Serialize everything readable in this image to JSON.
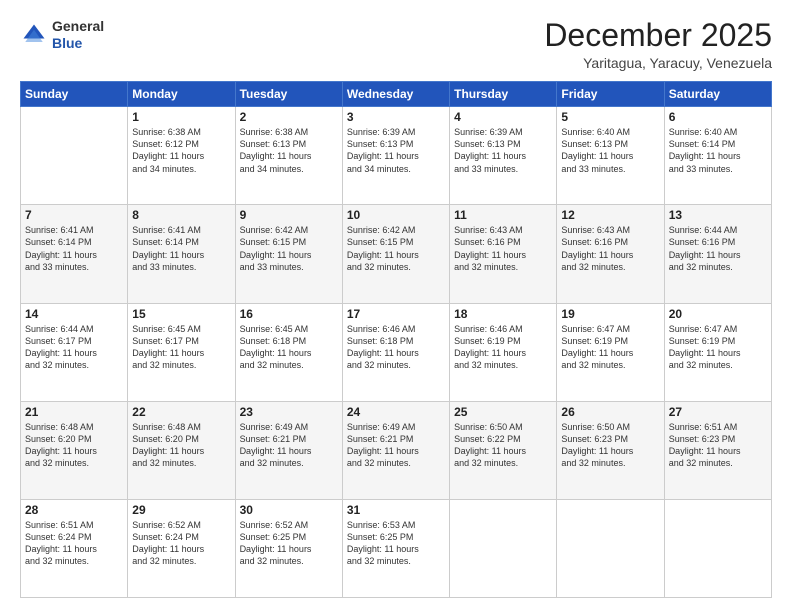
{
  "header": {
    "logo_line1": "General",
    "logo_line2": "Blue",
    "month": "December 2025",
    "location": "Yaritagua, Yaracuy, Venezuela"
  },
  "weekdays": [
    "Sunday",
    "Monday",
    "Tuesday",
    "Wednesday",
    "Thursday",
    "Friday",
    "Saturday"
  ],
  "weeks": [
    [
      {
        "day": "",
        "info": ""
      },
      {
        "day": "1",
        "info": "Sunrise: 6:38 AM\nSunset: 6:12 PM\nDaylight: 11 hours\nand 34 minutes."
      },
      {
        "day": "2",
        "info": "Sunrise: 6:38 AM\nSunset: 6:13 PM\nDaylight: 11 hours\nand 34 minutes."
      },
      {
        "day": "3",
        "info": "Sunrise: 6:39 AM\nSunset: 6:13 PM\nDaylight: 11 hours\nand 34 minutes."
      },
      {
        "day": "4",
        "info": "Sunrise: 6:39 AM\nSunset: 6:13 PM\nDaylight: 11 hours\nand 33 minutes."
      },
      {
        "day": "5",
        "info": "Sunrise: 6:40 AM\nSunset: 6:13 PM\nDaylight: 11 hours\nand 33 minutes."
      },
      {
        "day": "6",
        "info": "Sunrise: 6:40 AM\nSunset: 6:14 PM\nDaylight: 11 hours\nand 33 minutes."
      }
    ],
    [
      {
        "day": "7",
        "info": "Sunrise: 6:41 AM\nSunset: 6:14 PM\nDaylight: 11 hours\nand 33 minutes."
      },
      {
        "day": "8",
        "info": "Sunrise: 6:41 AM\nSunset: 6:14 PM\nDaylight: 11 hours\nand 33 minutes."
      },
      {
        "day": "9",
        "info": "Sunrise: 6:42 AM\nSunset: 6:15 PM\nDaylight: 11 hours\nand 33 minutes."
      },
      {
        "day": "10",
        "info": "Sunrise: 6:42 AM\nSunset: 6:15 PM\nDaylight: 11 hours\nand 32 minutes."
      },
      {
        "day": "11",
        "info": "Sunrise: 6:43 AM\nSunset: 6:16 PM\nDaylight: 11 hours\nand 32 minutes."
      },
      {
        "day": "12",
        "info": "Sunrise: 6:43 AM\nSunset: 6:16 PM\nDaylight: 11 hours\nand 32 minutes."
      },
      {
        "day": "13",
        "info": "Sunrise: 6:44 AM\nSunset: 6:16 PM\nDaylight: 11 hours\nand 32 minutes."
      }
    ],
    [
      {
        "day": "14",
        "info": "Sunrise: 6:44 AM\nSunset: 6:17 PM\nDaylight: 11 hours\nand 32 minutes."
      },
      {
        "day": "15",
        "info": "Sunrise: 6:45 AM\nSunset: 6:17 PM\nDaylight: 11 hours\nand 32 minutes."
      },
      {
        "day": "16",
        "info": "Sunrise: 6:45 AM\nSunset: 6:18 PM\nDaylight: 11 hours\nand 32 minutes."
      },
      {
        "day": "17",
        "info": "Sunrise: 6:46 AM\nSunset: 6:18 PM\nDaylight: 11 hours\nand 32 minutes."
      },
      {
        "day": "18",
        "info": "Sunrise: 6:46 AM\nSunset: 6:19 PM\nDaylight: 11 hours\nand 32 minutes."
      },
      {
        "day": "19",
        "info": "Sunrise: 6:47 AM\nSunset: 6:19 PM\nDaylight: 11 hours\nand 32 minutes."
      },
      {
        "day": "20",
        "info": "Sunrise: 6:47 AM\nSunset: 6:19 PM\nDaylight: 11 hours\nand 32 minutes."
      }
    ],
    [
      {
        "day": "21",
        "info": "Sunrise: 6:48 AM\nSunset: 6:20 PM\nDaylight: 11 hours\nand 32 minutes."
      },
      {
        "day": "22",
        "info": "Sunrise: 6:48 AM\nSunset: 6:20 PM\nDaylight: 11 hours\nand 32 minutes."
      },
      {
        "day": "23",
        "info": "Sunrise: 6:49 AM\nSunset: 6:21 PM\nDaylight: 11 hours\nand 32 minutes."
      },
      {
        "day": "24",
        "info": "Sunrise: 6:49 AM\nSunset: 6:21 PM\nDaylight: 11 hours\nand 32 minutes."
      },
      {
        "day": "25",
        "info": "Sunrise: 6:50 AM\nSunset: 6:22 PM\nDaylight: 11 hours\nand 32 minutes."
      },
      {
        "day": "26",
        "info": "Sunrise: 6:50 AM\nSunset: 6:23 PM\nDaylight: 11 hours\nand 32 minutes."
      },
      {
        "day": "27",
        "info": "Sunrise: 6:51 AM\nSunset: 6:23 PM\nDaylight: 11 hours\nand 32 minutes."
      }
    ],
    [
      {
        "day": "28",
        "info": "Sunrise: 6:51 AM\nSunset: 6:24 PM\nDaylight: 11 hours\nand 32 minutes."
      },
      {
        "day": "29",
        "info": "Sunrise: 6:52 AM\nSunset: 6:24 PM\nDaylight: 11 hours\nand 32 minutes."
      },
      {
        "day": "30",
        "info": "Sunrise: 6:52 AM\nSunset: 6:25 PM\nDaylight: 11 hours\nand 32 minutes."
      },
      {
        "day": "31",
        "info": "Sunrise: 6:53 AM\nSunset: 6:25 PM\nDaylight: 11 hours\nand 32 minutes."
      },
      {
        "day": "",
        "info": ""
      },
      {
        "day": "",
        "info": ""
      },
      {
        "day": "",
        "info": ""
      }
    ]
  ]
}
